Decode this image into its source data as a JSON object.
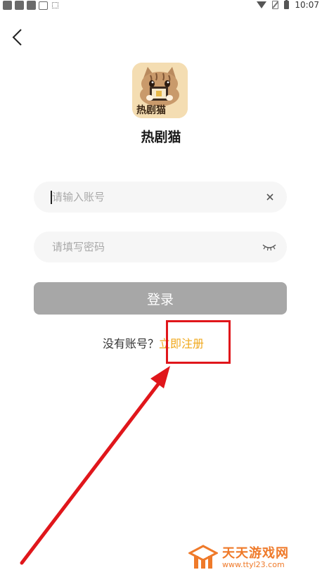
{
  "status_bar": {
    "time": "10:07"
  },
  "app": {
    "name": "热剧猫",
    "logo_text": "热剧猫"
  },
  "account": {
    "placeholder": "请输入账号",
    "value": ""
  },
  "password": {
    "placeholder": "请填写密码",
    "value": ""
  },
  "login": {
    "label": "登录"
  },
  "register": {
    "prompt": "没有账号？",
    "link": "立即注册"
  },
  "watermark": {
    "title": "天天游戏网",
    "url": "www.ttyl23.com"
  },
  "colors": {
    "accent": "#f0a81c",
    "login_disabled": "#a7a7a7",
    "annotation": "#e0161b"
  }
}
